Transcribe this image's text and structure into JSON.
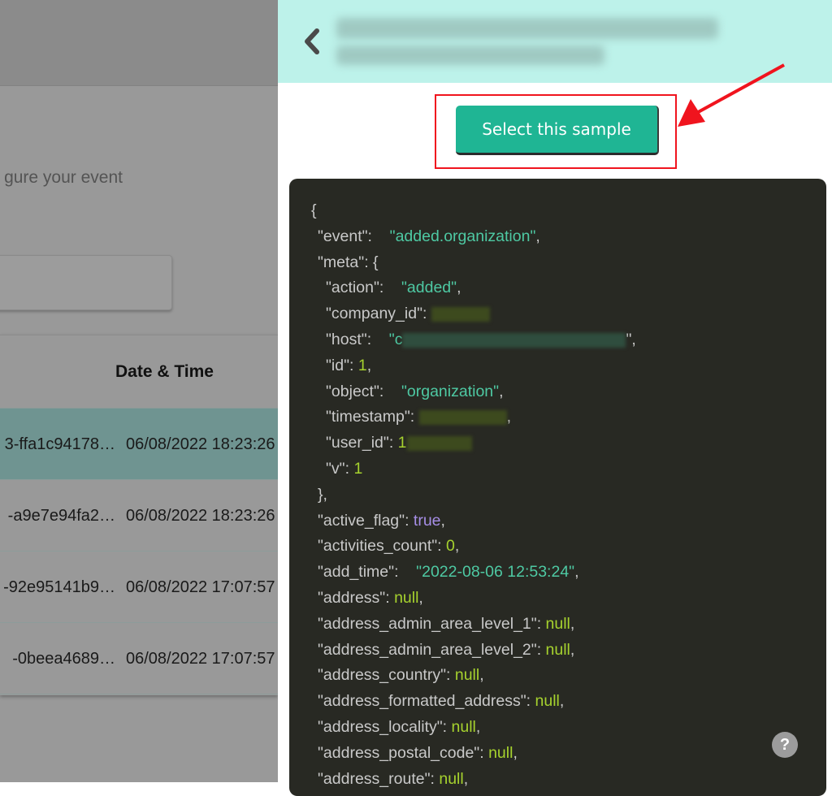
{
  "left": {
    "partial_text": "gure your event",
    "table": {
      "header_date": "Date & Time",
      "rows": [
        {
          "id": "3-ffa1c94178…",
          "datetime": "06/08/2022 18:23:26",
          "selected": true
        },
        {
          "id": "-a9e7e94fa2…",
          "datetime": "06/08/2022 18:23:26",
          "selected": false
        },
        {
          "id": "-92e95141b9…",
          "datetime": "06/08/2022 17:07:57",
          "selected": false
        },
        {
          "id": "-0beea4689…",
          "datetime": "06/08/2022 17:07:57",
          "selected": false
        }
      ]
    }
  },
  "right": {
    "header": {
      "back_icon": "chevron-left-icon",
      "title": "[redacted]"
    },
    "select_button": "Select this sample",
    "annotation": {
      "highlight_color": "#f0141e",
      "arrow": "red arrow pointing to button"
    },
    "code_lines": [
      {
        "indent": 0,
        "text": "{"
      },
      {
        "indent": 1,
        "key": "\"event\"",
        "type": "s",
        "value": "\"added.organization\"",
        "comma": true
      },
      {
        "indent": 1,
        "key": "\"meta\"",
        "text_after": ": {"
      },
      {
        "indent": 2,
        "key": "\"action\"",
        "type": "s",
        "value": "\"added\"",
        "comma": true
      },
      {
        "indent": 2,
        "key": "\"company_id\"",
        "type": "redacted",
        "redact_color": "#3d4a1e",
        "redact_w": 72
      },
      {
        "indent": 2,
        "key": "\"host\"",
        "type": "redacted-s",
        "prefix": "\"c",
        "redact_color": "#2f4d3e",
        "redact_w": 275,
        "suffix": "\","
      },
      {
        "indent": 2,
        "key": "\"id\"",
        "type": "n",
        "value": "1",
        "comma": true
      },
      {
        "indent": 2,
        "key": "\"object\"",
        "type": "s",
        "value": "\"organization\"",
        "comma": true
      },
      {
        "indent": 2,
        "key": "\"timestamp\"",
        "type": "redacted",
        "redact_color": "#3d4a1e",
        "redact_w": 108,
        "suffix": ","
      },
      {
        "indent": 2,
        "key": "\"user_id\"",
        "type": "redacted",
        "prefix": "1",
        "redact_color": "#3d4a1e",
        "redact_w": 80
      },
      {
        "indent": 2,
        "key": "\"v\"",
        "type": "n",
        "value": "1"
      },
      {
        "indent": 1,
        "text": "},"
      },
      {
        "indent": 1,
        "key": "\"active_flag\"",
        "type": "b",
        "value": "true",
        "comma": true
      },
      {
        "indent": 1,
        "key": "\"activities_count\"",
        "type": "n",
        "value": "0",
        "comma": true
      },
      {
        "indent": 1,
        "key": "\"add_time\"",
        "type": "s",
        "value": "\"2022-08-06 12:53:24\"",
        "comma": true
      },
      {
        "indent": 1,
        "key": "\"address\"",
        "type": "n",
        "value": "null",
        "comma": true
      },
      {
        "indent": 1,
        "key": "\"address_admin_area_level_1\"",
        "type": "n",
        "value": "null",
        "comma": true
      },
      {
        "indent": 1,
        "key": "\"address_admin_area_level_2\"",
        "type": "n",
        "value": "null",
        "comma": true
      },
      {
        "indent": 1,
        "key": "\"address_country\"",
        "type": "n",
        "value": "null",
        "comma": true
      },
      {
        "indent": 1,
        "key": "\"address_formatted_address\"",
        "type": "n",
        "value": "null",
        "comma": true
      },
      {
        "indent": 1,
        "key": "\"address_locality\"",
        "type": "n",
        "value": "null",
        "comma": true
      },
      {
        "indent": 1,
        "key": "\"address_postal_code\"",
        "type": "n",
        "value": "null",
        "comma": true
      },
      {
        "indent": 1,
        "key": "\"address_route\"",
        "type": "n",
        "value": "null",
        "comma": true
      }
    ],
    "help_button": "?"
  }
}
